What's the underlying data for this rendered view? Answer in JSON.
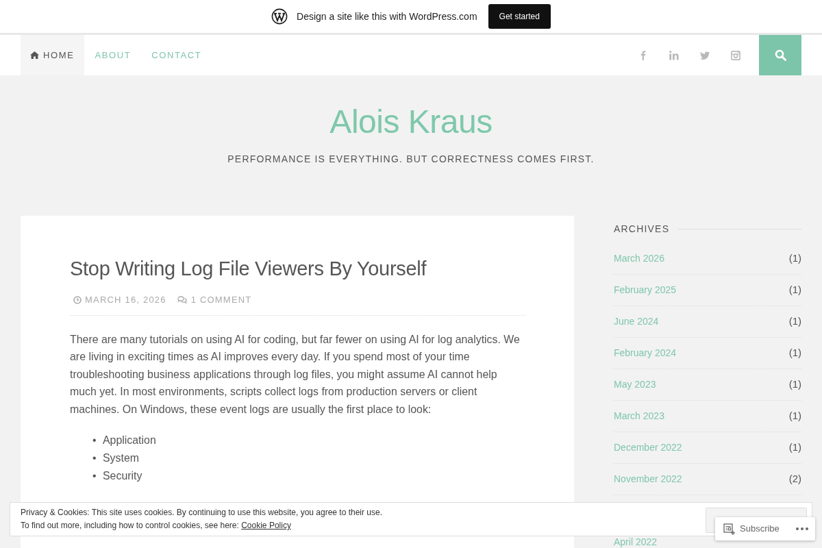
{
  "promo_bar": {
    "text": "Design a site like this with WordPress.com",
    "button": "Get started"
  },
  "nav": {
    "items": [
      {
        "label": "HOME",
        "selected": true
      },
      {
        "label": "ABOUT",
        "selected": false
      },
      {
        "label": "CONTACT",
        "selected": false
      }
    ]
  },
  "site": {
    "title": "Alois Kraus",
    "tagline": "PERFORMANCE IS EVERYTHING. BUT CORRECTNESS COMES FIRST."
  },
  "post": {
    "title": "Stop Writing Log File Viewers By Yourself",
    "date": "MARCH 16, 2026",
    "comments": "1 COMMENT",
    "paragraph": "There are many tutorials on using AI for coding, but far fewer on using AI for log analytics. We are living in exciting times as AI improves every day. If you spend most of your time troubleshooting business applications through log files, you might assume AI cannot help much yet. In most environments, scripts collect logs from production servers or client machines. On Windows, these event logs are usually the first place to look:",
    "bullets": [
      {
        "marker": "•",
        "text": "Application"
      },
      {
        "marker": "•",
        "text": "System"
      },
      {
        "marker": "•",
        "text": "Security"
      }
    ]
  },
  "sidebar": {
    "heading": "ARCHIVES",
    "archives": [
      {
        "month": "March 2026",
        "count": "(1)"
      },
      {
        "month": "February 2025",
        "count": "(1)"
      },
      {
        "month": "June 2024",
        "count": "(1)"
      },
      {
        "month": "February 2024",
        "count": "(1)"
      },
      {
        "month": "May 2023",
        "count": "(1)"
      },
      {
        "month": "March 2023",
        "count": "(1)"
      },
      {
        "month": "December 2022",
        "count": "(1)"
      },
      {
        "month": "November 2022",
        "count": "(2)"
      },
      {
        "month": "April 2022"
      }
    ]
  },
  "cookie_banner": {
    "line_1": "Privacy & Cookies: This site uses cookies. By continuing to use this website, you agree to their use.",
    "line_2": "To find out more, including how to control cookies, see here:",
    "link": "Cookie Policy"
  },
  "subscribe_bar": {
    "label": "Subscribe"
  }
}
